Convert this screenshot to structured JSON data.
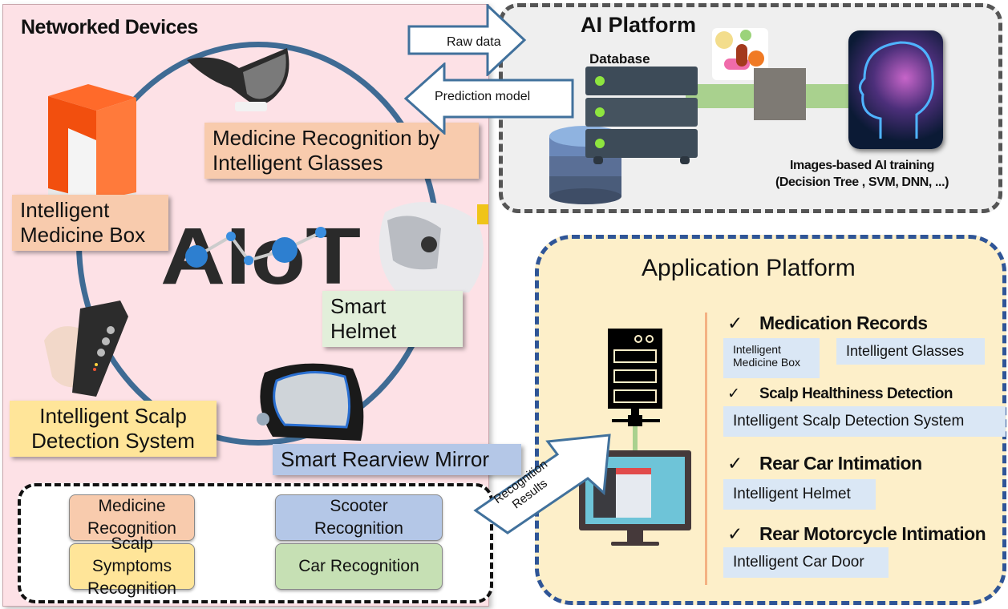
{
  "networked_devices": {
    "title": "Networked Devices",
    "logo_text": "AIoT",
    "devices": [
      {
        "label_line1": "Medicine Recognition by",
        "label_line2": "Intelligent Glasses",
        "color": "#f8cbad",
        "icon": "smart-glasses-icon"
      },
      {
        "label_line1": "Intelligent",
        "label_line2": "Medicine Box",
        "color": "#f8cbad",
        "icon": "medicine-box-icon"
      },
      {
        "label_line1": "Smart Helmet",
        "label_line2": "",
        "color": "#e2efda",
        "icon": "helmet-icon"
      },
      {
        "label_line1": "Intelligent Scalp",
        "label_line2": "Detection System",
        "color": "#ffe599",
        "icon": "scalp-detector-icon"
      },
      {
        "label_line1": "Smart Rearview Mirror",
        "label_line2": "",
        "color": "#b4c7e7",
        "icon": "rearview-mirror-icon"
      }
    ],
    "recognition": [
      {
        "line1": "Medicine",
        "line2": "Recognition",
        "color": "#f8cbad"
      },
      {
        "line1": "Scooter",
        "line2": "Recognition",
        "color": "#b4c7e7"
      },
      {
        "line1": "Scalp Symptoms",
        "line2": "Recognition",
        "color": "#ffe599"
      },
      {
        "line1": "Car Recognition",
        "line2": "",
        "color": "#c6e0b4"
      }
    ]
  },
  "arrows": {
    "raw_data": "Raw data",
    "prediction_model": "Prediction model",
    "recognition_results_line1": "Recognition",
    "recognition_results_line2": "Results"
  },
  "ai_platform": {
    "title": "AI Platform",
    "database_label": "Database",
    "training_line1": "Images-based AI training",
    "training_line2": "(Decision Tree , SVM,  DNN, ...)"
  },
  "app_platform": {
    "title": "Application Platform",
    "check_symbol": "✓",
    "sections": [
      {
        "heading": "Medication Records",
        "tags": [
          "Intelligent Medicine Box",
          "Intelligent Glasses"
        ]
      },
      {
        "heading": "Scalp Healthiness Detection",
        "tags": [
          "Intelligent Scalp Detection System"
        ]
      },
      {
        "heading": "Rear Car Intimation",
        "tags": [
          "Intelligent Helmet"
        ]
      },
      {
        "heading": "Rear Motorcycle Intimation",
        "tags": [
          "Intelligent Car Door"
        ]
      }
    ],
    "tag_medicine_box_line1": "Intelligent",
    "tag_medicine_box_line2": "Medicine Box"
  }
}
